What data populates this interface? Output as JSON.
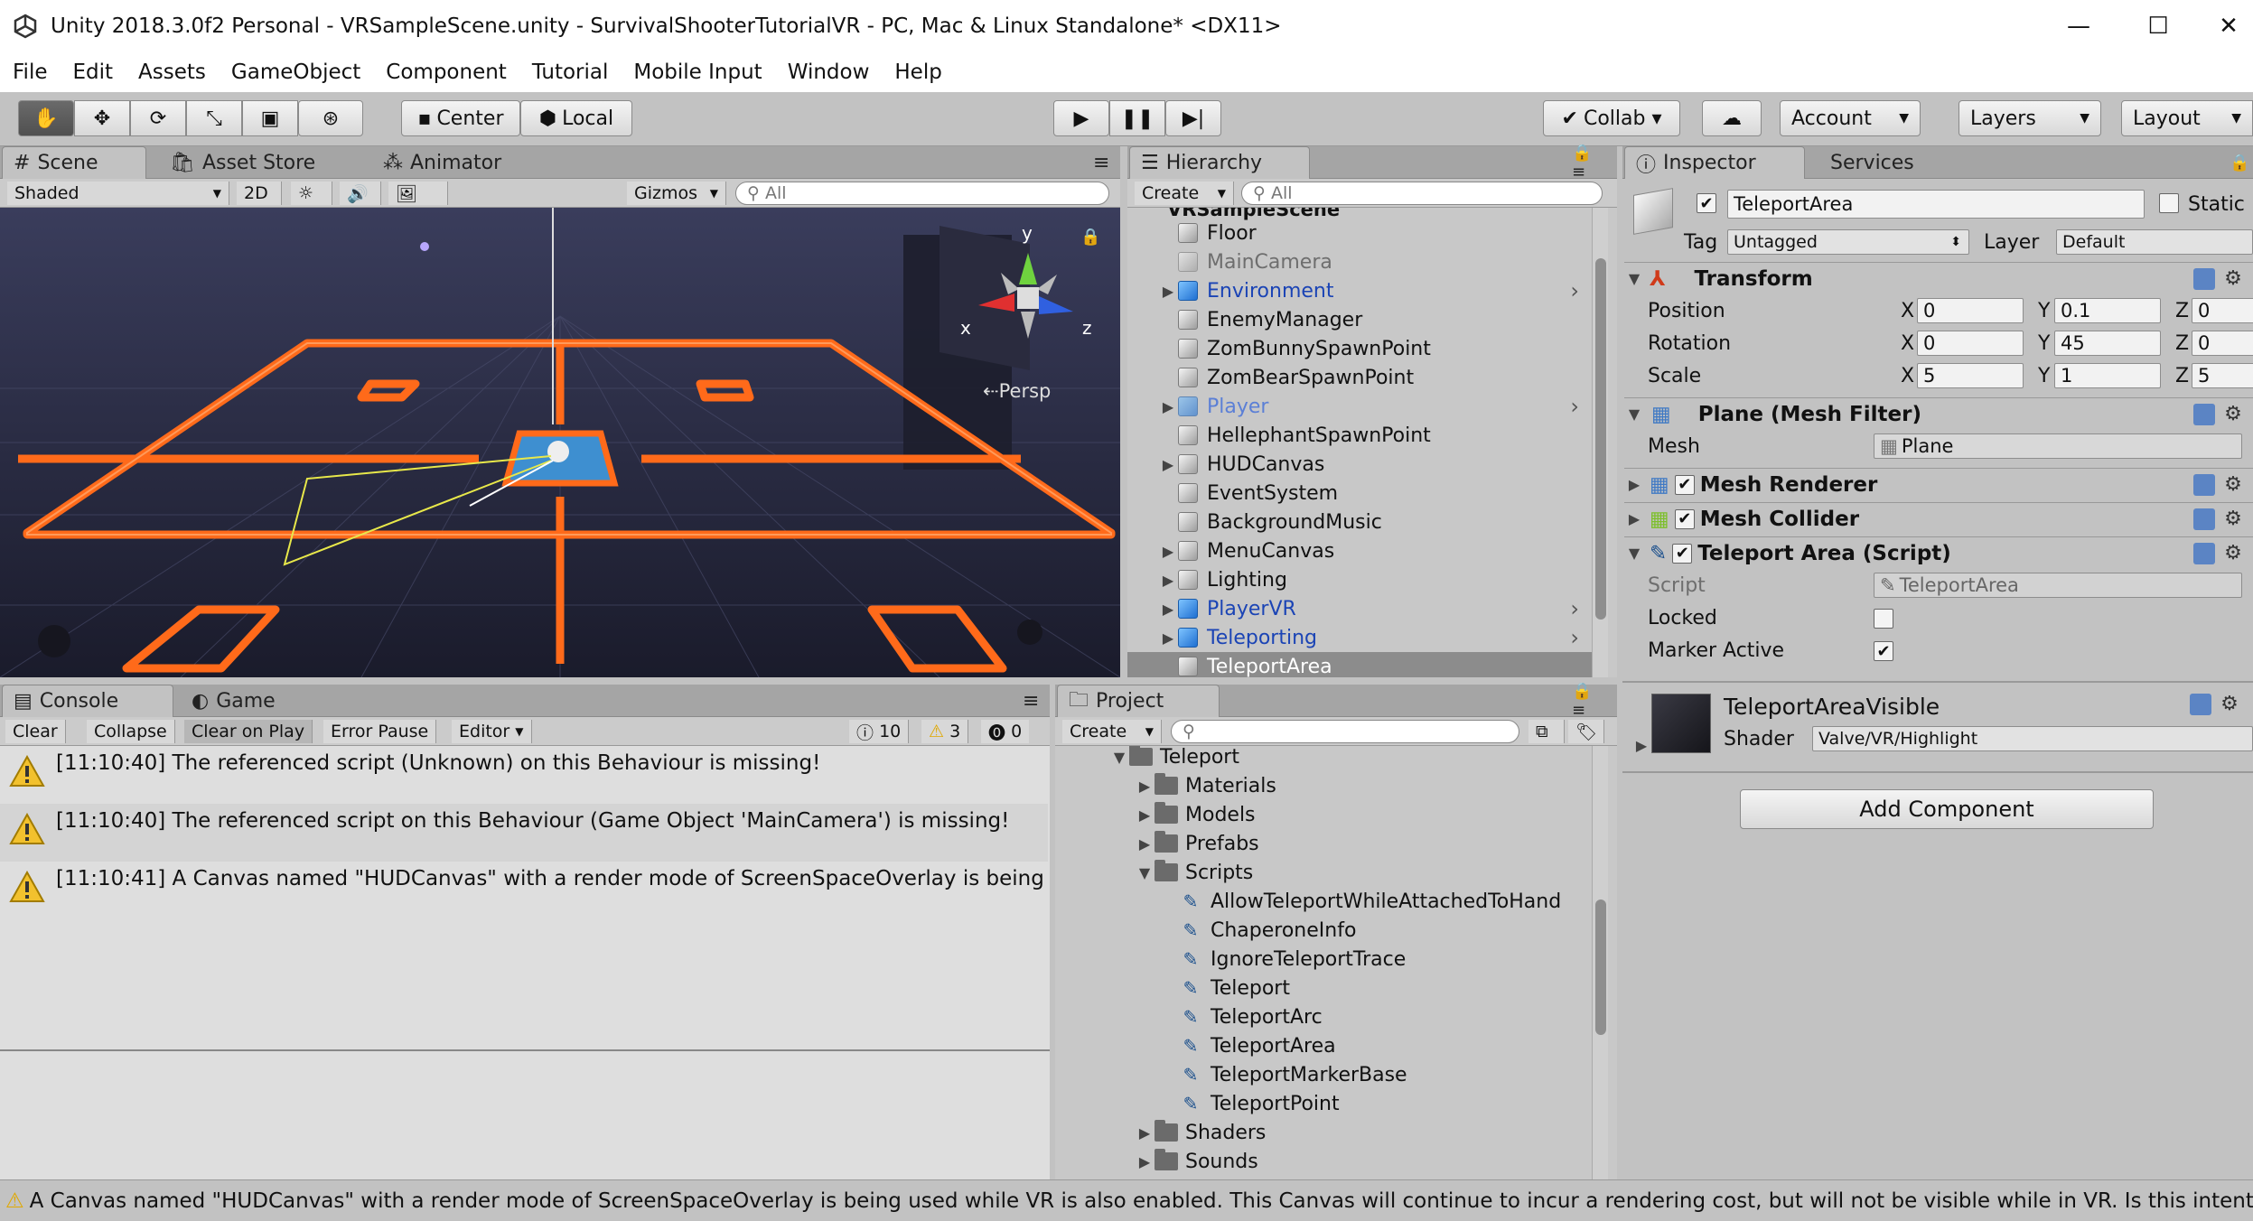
{
  "window": {
    "title": "Unity 2018.3.0f2 Personal - VRSampleScene.unity - SurvivalShooterTutorialVR - PC, Mac & Linux Standalone* <DX11>",
    "minimize": "—",
    "maximize": "☐",
    "close": "✕"
  },
  "menu": [
    "File",
    "Edit",
    "Assets",
    "GameObject",
    "Component",
    "Tutorial",
    "Mobile Input",
    "Window",
    "Help"
  ],
  "toolbar": {
    "pivot": "Center",
    "space": "Local",
    "collab": "Collab ▾",
    "account": "Account",
    "layers": "Layers",
    "layout": "Layout"
  },
  "scene": {
    "tabs": [
      "Scene",
      "Asset Store",
      "Animator"
    ],
    "shading": "Shaded",
    "mode2d": "2D",
    "gizmos": "Gizmos",
    "search_placeholder": "All",
    "persp": "Persp",
    "axis_y": "y",
    "axis_x": "x",
    "axis_z": "z"
  },
  "hierarchy": {
    "tab": "Hierarchy",
    "create": "Create",
    "search_placeholder": "All",
    "scene_name": "VRSampleScene",
    "items": [
      {
        "label": "Floor",
        "expand": "",
        "style": "normal",
        "more": ""
      },
      {
        "label": "MainCamera",
        "expand": "",
        "style": "gray",
        "more": ""
      },
      {
        "label": "Environment",
        "expand": "▶",
        "style": "blue",
        "more": "›"
      },
      {
        "label": "EnemyManager",
        "expand": "",
        "style": "normal",
        "more": ""
      },
      {
        "label": "ZomBunnySpawnPoint",
        "expand": "",
        "style": "normal",
        "more": ""
      },
      {
        "label": "ZomBearSpawnPoint",
        "expand": "",
        "style": "normal",
        "more": ""
      },
      {
        "label": "Player",
        "expand": "▶",
        "style": "bluelight",
        "more": "›"
      },
      {
        "label": "HellephantSpawnPoint",
        "expand": "",
        "style": "normal",
        "more": ""
      },
      {
        "label": "HUDCanvas",
        "expand": "▶",
        "style": "normal",
        "more": ""
      },
      {
        "label": "EventSystem",
        "expand": "",
        "style": "normal",
        "more": ""
      },
      {
        "label": "BackgroundMusic",
        "expand": "",
        "style": "normal",
        "more": ""
      },
      {
        "label": "MenuCanvas",
        "expand": "▶",
        "style": "normal",
        "more": ""
      },
      {
        "label": "Lighting",
        "expand": "▶",
        "style": "normal",
        "more": ""
      },
      {
        "label": "PlayerVR",
        "expand": "▶",
        "style": "blue",
        "more": "›"
      },
      {
        "label": "Teleporting",
        "expand": "▶",
        "style": "blue",
        "more": "›"
      },
      {
        "label": "TeleportArea",
        "expand": "",
        "style": "selected",
        "more": ""
      }
    ]
  },
  "inspector": {
    "tabs": [
      "Inspector",
      "Services"
    ],
    "object_name": "TeleportArea",
    "static_label": "Static",
    "tag_label": "Tag",
    "tag_value": "Untagged",
    "layer_label": "Layer",
    "layer_value": "Default",
    "transform": {
      "title": "Transform",
      "position_label": "Position",
      "rotation_label": "Rotation",
      "scale_label": "Scale",
      "x": "X",
      "y": "Y",
      "z": "Z",
      "position": [
        "0",
        "0.1",
        "0"
      ],
      "rotation": [
        "0",
        "45",
        "0"
      ],
      "scale": [
        "5",
        "1",
        "5"
      ]
    },
    "mesh_filter": {
      "title": "Plane (Mesh Filter)",
      "mesh_label": "Mesh",
      "mesh_value": "Plane"
    },
    "mesh_renderer": {
      "title": "Mesh Renderer"
    },
    "mesh_collider": {
      "title": "Mesh Collider"
    },
    "teleport_area": {
      "title": "Teleport Area (Script)",
      "script_label": "Script",
      "script_value": "TeleportArea",
      "locked_label": "Locked",
      "marker_label": "Marker Active",
      "locked": false,
      "marker_active": true
    },
    "material": {
      "name": "TeleportAreaVisible",
      "shader_label": "Shader",
      "shader_value": "Valve/VR/Highlight"
    },
    "add_component": "Add Component"
  },
  "console": {
    "tabs": [
      "Console",
      "Game"
    ],
    "buttons": [
      "Clear",
      "Collapse",
      "Clear on Play",
      "Error Pause",
      "Editor"
    ],
    "count_info": "10",
    "count_warn": "3",
    "count_error": "0",
    "messages": [
      "[11:10:40] The referenced script (Unknown) on this Behaviour is missing!",
      "[11:10:40] The referenced script on this Behaviour (Game Object 'MainCamera') is missing!",
      "[11:10:41] A Canvas named \"HUDCanvas\" with a render mode of ScreenSpaceOverlay is being"
    ]
  },
  "project": {
    "tab": "Project",
    "create": "Create",
    "items": [
      {
        "label": "Teleport",
        "expand": "▼",
        "type": "folder",
        "indent": 0
      },
      {
        "label": "Materials",
        "expand": "▶",
        "type": "folder",
        "indent": 1
      },
      {
        "label": "Models",
        "expand": "▶",
        "type": "folder",
        "indent": 1
      },
      {
        "label": "Prefabs",
        "expand": "▶",
        "type": "folder",
        "indent": 1
      },
      {
        "label": "Scripts",
        "expand": "▼",
        "type": "folder",
        "indent": 1
      },
      {
        "label": "AllowTeleportWhileAttachedToHand",
        "expand": "",
        "type": "script",
        "indent": 2
      },
      {
        "label": "ChaperoneInfo",
        "expand": "",
        "type": "script",
        "indent": 2
      },
      {
        "label": "IgnoreTeleportTrace",
        "expand": "",
        "type": "script",
        "indent": 2
      },
      {
        "label": "Teleport",
        "expand": "",
        "type": "script",
        "indent": 2
      },
      {
        "label": "TeleportArc",
        "expand": "",
        "type": "script",
        "indent": 2
      },
      {
        "label": "TeleportArea",
        "expand": "",
        "type": "script",
        "indent": 2
      },
      {
        "label": "TeleportMarkerBase",
        "expand": "",
        "type": "script",
        "indent": 2
      },
      {
        "label": "TeleportPoint",
        "expand": "",
        "type": "script",
        "indent": 2
      },
      {
        "label": "Shaders",
        "expand": "▶",
        "type": "folder",
        "indent": 1
      },
      {
        "label": "Sounds",
        "expand": "▶",
        "type": "folder",
        "indent": 1
      }
    ]
  },
  "status": {
    "message": "A Canvas named \"HUDCanvas\" with a render mode of ScreenSpaceOverlay is being used while VR is also enabled. This Canvas will continue to incur a rendering cost, but will not be visible while in VR. Is this intentional?"
  },
  "colors": {
    "accent": "#ff6a1a",
    "selection": "#8c8c8c",
    "blue_label": "#1b44b5"
  }
}
